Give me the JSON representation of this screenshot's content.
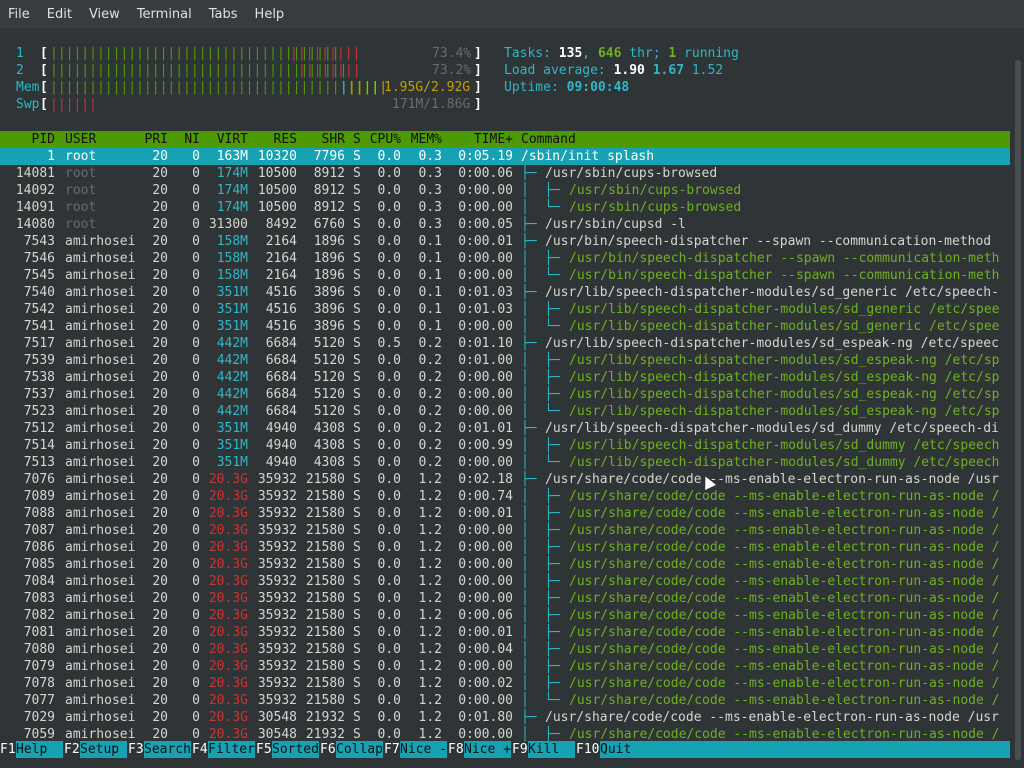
{
  "menu": [
    "File",
    "Edit",
    "View",
    "Terminal",
    "Tabs",
    "Help"
  ],
  "cpu": [
    {
      "num": "1",
      "green": "|||||||||||||||||||||||||||||||||||||",
      "red": "|||||||||",
      "pct": "73.4%"
    },
    {
      "num": "2",
      "green": "||||||||||||||||||||||||||||||||||||||",
      "red": "||||||||",
      "pct": "73.2%"
    }
  ],
  "mem": {
    "label": "Mem",
    "green": "||||||||||||||||||||||||||||||||||||||||||",
    "blue": "|",
    "yellow": "|||||",
    "value": "1.95G/2.92G"
  },
  "swp": {
    "label": "Swp",
    "red": "||||||",
    "value": "171M/1.86G"
  },
  "tasks": {
    "label": "Tasks: ",
    "count": "135",
    "sep": ", ",
    "threads": "646",
    "thr_label": " thr; ",
    "running": "1",
    "running_label": " running"
  },
  "load": {
    "label": "Load average: ",
    "one": "1.90",
    "five": "1.67",
    "fifteen": "1.52"
  },
  "uptime": {
    "label": "Uptime: ",
    "value": "09:00:48"
  },
  "header": [
    "PID",
    "USER",
    "PRI",
    "NI",
    "VIRT",
    "RES",
    "SHR",
    "S",
    "CPU%",
    "MEM%",
    "TIME+",
    "Command"
  ],
  "processes": [
    {
      "pid": "1",
      "user": "root",
      "pri": "20",
      "ni": "0",
      "virt": "163M",
      "res": "10320",
      "shr": "7796",
      "s": "S",
      "cpu": "0.0",
      "mem": "0.3",
      "time": "0:05.19",
      "tree": "",
      "cmd": "/sbin/init splash",
      "sel": true
    },
    {
      "pid": "14081",
      "user": "root",
      "pri": "20",
      "ni": "0",
      "virt": "174M",
      "res": "10500",
      "shr": "8912",
      "s": "S",
      "cpu": "0.0",
      "mem": "0.3",
      "time": "0:00.06",
      "tree": "├─ ",
      "cmd": "/usr/sbin/cups-browsed",
      "child": false
    },
    {
      "pid": "14092",
      "user": "root",
      "pri": "20",
      "ni": "0",
      "virt": "174M",
      "res": "10500",
      "shr": "8912",
      "s": "S",
      "cpu": "0.0",
      "mem": "0.3",
      "time": "0:00.00",
      "tree": "│  ├─ ",
      "cmd": "/usr/sbin/cups-browsed",
      "child": true
    },
    {
      "pid": "14091",
      "user": "root",
      "pri": "20",
      "ni": "0",
      "virt": "174M",
      "res": "10500",
      "shr": "8912",
      "s": "S",
      "cpu": "0.0",
      "mem": "0.3",
      "time": "0:00.00",
      "tree": "│  └─ ",
      "cmd": "/usr/sbin/cups-browsed",
      "child": true
    },
    {
      "pid": "14080",
      "user": "root",
      "pri": "20",
      "ni": "0",
      "virt": "31300",
      "res": "8492",
      "shr": "6760",
      "s": "S",
      "cpu": "0.0",
      "mem": "0.3",
      "time": "0:00.05",
      "tree": "├─ ",
      "cmd": "/usr/sbin/cupsd -l",
      "child": false
    },
    {
      "pid": "7543",
      "user": "amirhosei",
      "pri": "20",
      "ni": "0",
      "virt": "158M",
      "res": "2164",
      "shr": "1896",
      "s": "S",
      "cpu": "0.0",
      "mem": "0.1",
      "time": "0:00.01",
      "tree": "├─ ",
      "cmd": "/usr/bin/speech-dispatcher --spawn --communication-method",
      "child": false
    },
    {
      "pid": "7546",
      "user": "amirhosei",
      "pri": "20",
      "ni": "0",
      "virt": "158M",
      "res": "2164",
      "shr": "1896",
      "s": "S",
      "cpu": "0.0",
      "mem": "0.1",
      "time": "0:00.00",
      "tree": "│  ├─ ",
      "cmd": "/usr/bin/speech-dispatcher --spawn --communication-meth",
      "child": true
    },
    {
      "pid": "7545",
      "user": "amirhosei",
      "pri": "20",
      "ni": "0",
      "virt": "158M",
      "res": "2164",
      "shr": "1896",
      "s": "S",
      "cpu": "0.0",
      "mem": "0.1",
      "time": "0:00.00",
      "tree": "│  └─ ",
      "cmd": "/usr/bin/speech-dispatcher --spawn --communication-meth",
      "child": true
    },
    {
      "pid": "7540",
      "user": "amirhosei",
      "pri": "20",
      "ni": "0",
      "virt": "351M",
      "res": "4516",
      "shr": "3896",
      "s": "S",
      "cpu": "0.0",
      "mem": "0.1",
      "time": "0:01.03",
      "tree": "├─ ",
      "cmd": "/usr/lib/speech-dispatcher-modules/sd_generic /etc/speech-",
      "child": false
    },
    {
      "pid": "7542",
      "user": "amirhosei",
      "pri": "20",
      "ni": "0",
      "virt": "351M",
      "res": "4516",
      "shr": "3896",
      "s": "S",
      "cpu": "0.0",
      "mem": "0.1",
      "time": "0:01.03",
      "tree": "│  ├─ ",
      "cmd": "/usr/lib/speech-dispatcher-modules/sd_generic /etc/spee",
      "child": true
    },
    {
      "pid": "7541",
      "user": "amirhosei",
      "pri": "20",
      "ni": "0",
      "virt": "351M",
      "res": "4516",
      "shr": "3896",
      "s": "S",
      "cpu": "0.0",
      "mem": "0.1",
      "time": "0:00.00",
      "tree": "│  └─ ",
      "cmd": "/usr/lib/speech-dispatcher-modules/sd_generic /etc/spee",
      "child": true
    },
    {
      "pid": "7517",
      "user": "amirhosei",
      "pri": "20",
      "ni": "0",
      "virt": "442M",
      "res": "6684",
      "shr": "5120",
      "s": "S",
      "cpu": "0.5",
      "mem": "0.2",
      "time": "0:01.10",
      "tree": "├─ ",
      "cmd": "/usr/lib/speech-dispatcher-modules/sd_espeak-ng /etc/speec",
      "child": false
    },
    {
      "pid": "7539",
      "user": "amirhosei",
      "pri": "20",
      "ni": "0",
      "virt": "442M",
      "res": "6684",
      "shr": "5120",
      "s": "S",
      "cpu": "0.0",
      "mem": "0.2",
      "time": "0:01.00",
      "tree": "│  ├─ ",
      "cmd": "/usr/lib/speech-dispatcher-modules/sd_espeak-ng /etc/sp",
      "child": true
    },
    {
      "pid": "7538",
      "user": "amirhosei",
      "pri": "20",
      "ni": "0",
      "virt": "442M",
      "res": "6684",
      "shr": "5120",
      "s": "S",
      "cpu": "0.0",
      "mem": "0.2",
      "time": "0:00.00",
      "tree": "│  ├─ ",
      "cmd": "/usr/lib/speech-dispatcher-modules/sd_espeak-ng /etc/sp",
      "child": true
    },
    {
      "pid": "7537",
      "user": "amirhosei",
      "pri": "20",
      "ni": "0",
      "virt": "442M",
      "res": "6684",
      "shr": "5120",
      "s": "S",
      "cpu": "0.0",
      "mem": "0.2",
      "time": "0:00.00",
      "tree": "│  ├─ ",
      "cmd": "/usr/lib/speech-dispatcher-modules/sd_espeak-ng /etc/sp",
      "child": true
    },
    {
      "pid": "7523",
      "user": "amirhosei",
      "pri": "20",
      "ni": "0",
      "virt": "442M",
      "res": "6684",
      "shr": "5120",
      "s": "S",
      "cpu": "0.0",
      "mem": "0.2",
      "time": "0:00.00",
      "tree": "│  └─ ",
      "cmd": "/usr/lib/speech-dispatcher-modules/sd_espeak-ng /etc/sp",
      "child": true
    },
    {
      "pid": "7512",
      "user": "amirhosei",
      "pri": "20",
      "ni": "0",
      "virt": "351M",
      "res": "4940",
      "shr": "4308",
      "s": "S",
      "cpu": "0.0",
      "mem": "0.2",
      "time": "0:01.01",
      "tree": "├─ ",
      "cmd": "/usr/lib/speech-dispatcher-modules/sd_dummy /etc/speech-di",
      "child": false
    },
    {
      "pid": "7514",
      "user": "amirhosei",
      "pri": "20",
      "ni": "0",
      "virt": "351M",
      "res": "4940",
      "shr": "4308",
      "s": "S",
      "cpu": "0.0",
      "mem": "0.2",
      "time": "0:00.99",
      "tree": "│  ├─ ",
      "cmd": "/usr/lib/speech-dispatcher-modules/sd_dummy /etc/speech",
      "child": true
    },
    {
      "pid": "7513",
      "user": "amirhosei",
      "pri": "20",
      "ni": "0",
      "virt": "351M",
      "res": "4940",
      "shr": "4308",
      "s": "S",
      "cpu": "0.0",
      "mem": "0.2",
      "time": "0:00.00",
      "tree": "│  └─ ",
      "cmd": "/usr/lib/speech-dispatcher-modules/sd_dummy /etc/speech",
      "child": true
    },
    {
      "pid": "7076",
      "user": "amirhosei",
      "pri": "20",
      "ni": "0",
      "virt": "20.3G",
      "res": "35932",
      "shr": "21580",
      "s": "S",
      "cpu": "0.0",
      "mem": "1.2",
      "time": "0:02.18",
      "tree": "├─ ",
      "cmd": "/usr/share/code/code --ms-enable-electron-run-as-node /usr",
      "child": false
    },
    {
      "pid": "7089",
      "user": "amirhosei",
      "pri": "20",
      "ni": "0",
      "virt": "20.3G",
      "res": "35932",
      "shr": "21580",
      "s": "S",
      "cpu": "0.0",
      "mem": "1.2",
      "time": "0:00.74",
      "tree": "│  ├─ ",
      "cmd": "/usr/share/code/code --ms-enable-electron-run-as-node /",
      "child": true
    },
    {
      "pid": "7088",
      "user": "amirhosei",
      "pri": "20",
      "ni": "0",
      "virt": "20.3G",
      "res": "35932",
      "shr": "21580",
      "s": "S",
      "cpu": "0.0",
      "mem": "1.2",
      "time": "0:00.01",
      "tree": "│  ├─ ",
      "cmd": "/usr/share/code/code --ms-enable-electron-run-as-node /",
      "child": true
    },
    {
      "pid": "7087",
      "user": "amirhosei",
      "pri": "20",
      "ni": "0",
      "virt": "20.3G",
      "res": "35932",
      "shr": "21580",
      "s": "S",
      "cpu": "0.0",
      "mem": "1.2",
      "time": "0:00.00",
      "tree": "│  ├─ ",
      "cmd": "/usr/share/code/code --ms-enable-electron-run-as-node /",
      "child": true
    },
    {
      "pid": "7086",
      "user": "amirhosei",
      "pri": "20",
      "ni": "0",
      "virt": "20.3G",
      "res": "35932",
      "shr": "21580",
      "s": "S",
      "cpu": "0.0",
      "mem": "1.2",
      "time": "0:00.00",
      "tree": "│  ├─ ",
      "cmd": "/usr/share/code/code --ms-enable-electron-run-as-node /",
      "child": true
    },
    {
      "pid": "7085",
      "user": "amirhosei",
      "pri": "20",
      "ni": "0",
      "virt": "20.3G",
      "res": "35932",
      "shr": "21580",
      "s": "S",
      "cpu": "0.0",
      "mem": "1.2",
      "time": "0:00.00",
      "tree": "│  ├─ ",
      "cmd": "/usr/share/code/code --ms-enable-electron-run-as-node /",
      "child": true
    },
    {
      "pid": "7084",
      "user": "amirhosei",
      "pri": "20",
      "ni": "0",
      "virt": "20.3G",
      "res": "35932",
      "shr": "21580",
      "s": "S",
      "cpu": "0.0",
      "mem": "1.2",
      "time": "0:00.00",
      "tree": "│  ├─ ",
      "cmd": "/usr/share/code/code --ms-enable-electron-run-as-node /",
      "child": true
    },
    {
      "pid": "7083",
      "user": "amirhosei",
      "pri": "20",
      "ni": "0",
      "virt": "20.3G",
      "res": "35932",
      "shr": "21580",
      "s": "S",
      "cpu": "0.0",
      "mem": "1.2",
      "time": "0:00.00",
      "tree": "│  ├─ ",
      "cmd": "/usr/share/code/code --ms-enable-electron-run-as-node /",
      "child": true
    },
    {
      "pid": "7082",
      "user": "amirhosei",
      "pri": "20",
      "ni": "0",
      "virt": "20.3G",
      "res": "35932",
      "shr": "21580",
      "s": "S",
      "cpu": "0.0",
      "mem": "1.2",
      "time": "0:00.06",
      "tree": "│  ├─ ",
      "cmd": "/usr/share/code/code --ms-enable-electron-run-as-node /",
      "child": true
    },
    {
      "pid": "7081",
      "user": "amirhosei",
      "pri": "20",
      "ni": "0",
      "virt": "20.3G",
      "res": "35932",
      "shr": "21580",
      "s": "S",
      "cpu": "0.0",
      "mem": "1.2",
      "time": "0:00.01",
      "tree": "│  ├─ ",
      "cmd": "/usr/share/code/code --ms-enable-electron-run-as-node /",
      "child": true
    },
    {
      "pid": "7080",
      "user": "amirhosei",
      "pri": "20",
      "ni": "0",
      "virt": "20.3G",
      "res": "35932",
      "shr": "21580",
      "s": "S",
      "cpu": "0.0",
      "mem": "1.2",
      "time": "0:00.04",
      "tree": "│  ├─ ",
      "cmd": "/usr/share/code/code --ms-enable-electron-run-as-node /",
      "child": true
    },
    {
      "pid": "7079",
      "user": "amirhosei",
      "pri": "20",
      "ni": "0",
      "virt": "20.3G",
      "res": "35932",
      "shr": "21580",
      "s": "S",
      "cpu": "0.0",
      "mem": "1.2",
      "time": "0:00.00",
      "tree": "│  ├─ ",
      "cmd": "/usr/share/code/code --ms-enable-electron-run-as-node /",
      "child": true
    },
    {
      "pid": "7078",
      "user": "amirhosei",
      "pri": "20",
      "ni": "0",
      "virt": "20.3G",
      "res": "35932",
      "shr": "21580",
      "s": "S",
      "cpu": "0.0",
      "mem": "1.2",
      "time": "0:00.02",
      "tree": "│  ├─ ",
      "cmd": "/usr/share/code/code --ms-enable-electron-run-as-node /",
      "child": true
    },
    {
      "pid": "7077",
      "user": "amirhosei",
      "pri": "20",
      "ni": "0",
      "virt": "20.3G",
      "res": "35932",
      "shr": "21580",
      "s": "S",
      "cpu": "0.0",
      "mem": "1.2",
      "time": "0:00.00",
      "tree": "│  └─ ",
      "cmd": "/usr/share/code/code --ms-enable-electron-run-as-node /",
      "child": true
    },
    {
      "pid": "7029",
      "user": "amirhosei",
      "pri": "20",
      "ni": "0",
      "virt": "20.3G",
      "res": "30548",
      "shr": "21932",
      "s": "S",
      "cpu": "0.0",
      "mem": "1.2",
      "time": "0:01.80",
      "tree": "├─ ",
      "cmd": "/usr/share/code/code --ms-enable-electron-run-as-node /usr",
      "child": false
    },
    {
      "pid": "7059",
      "user": "amirhosei",
      "pri": "20",
      "ni": "0",
      "virt": "20.3G",
      "res": "30548",
      "shr": "21932",
      "s": "S",
      "cpu": "0.0",
      "mem": "1.2",
      "time": "0:00.00",
      "tree": "│  ├─ ",
      "cmd": "/usr/share/code/code --ms-enable-electron-run-as-node /",
      "child": true
    }
  ],
  "fkeys": [
    {
      "key": "F1",
      "label": "Help  "
    },
    {
      "key": "F2",
      "label": "Setup "
    },
    {
      "key": "F3",
      "label": "Search"
    },
    {
      "key": "F4",
      "label": "Filter"
    },
    {
      "key": "F5",
      "label": "Sorted"
    },
    {
      "key": "F6",
      "label": "Collap"
    },
    {
      "key": "F7",
      "label": "Nice -"
    },
    {
      "key": "F8",
      "label": "Nice +"
    },
    {
      "key": "F9",
      "label": "Kill  "
    },
    {
      "key": "F10",
      "label": "Quit"
    }
  ]
}
